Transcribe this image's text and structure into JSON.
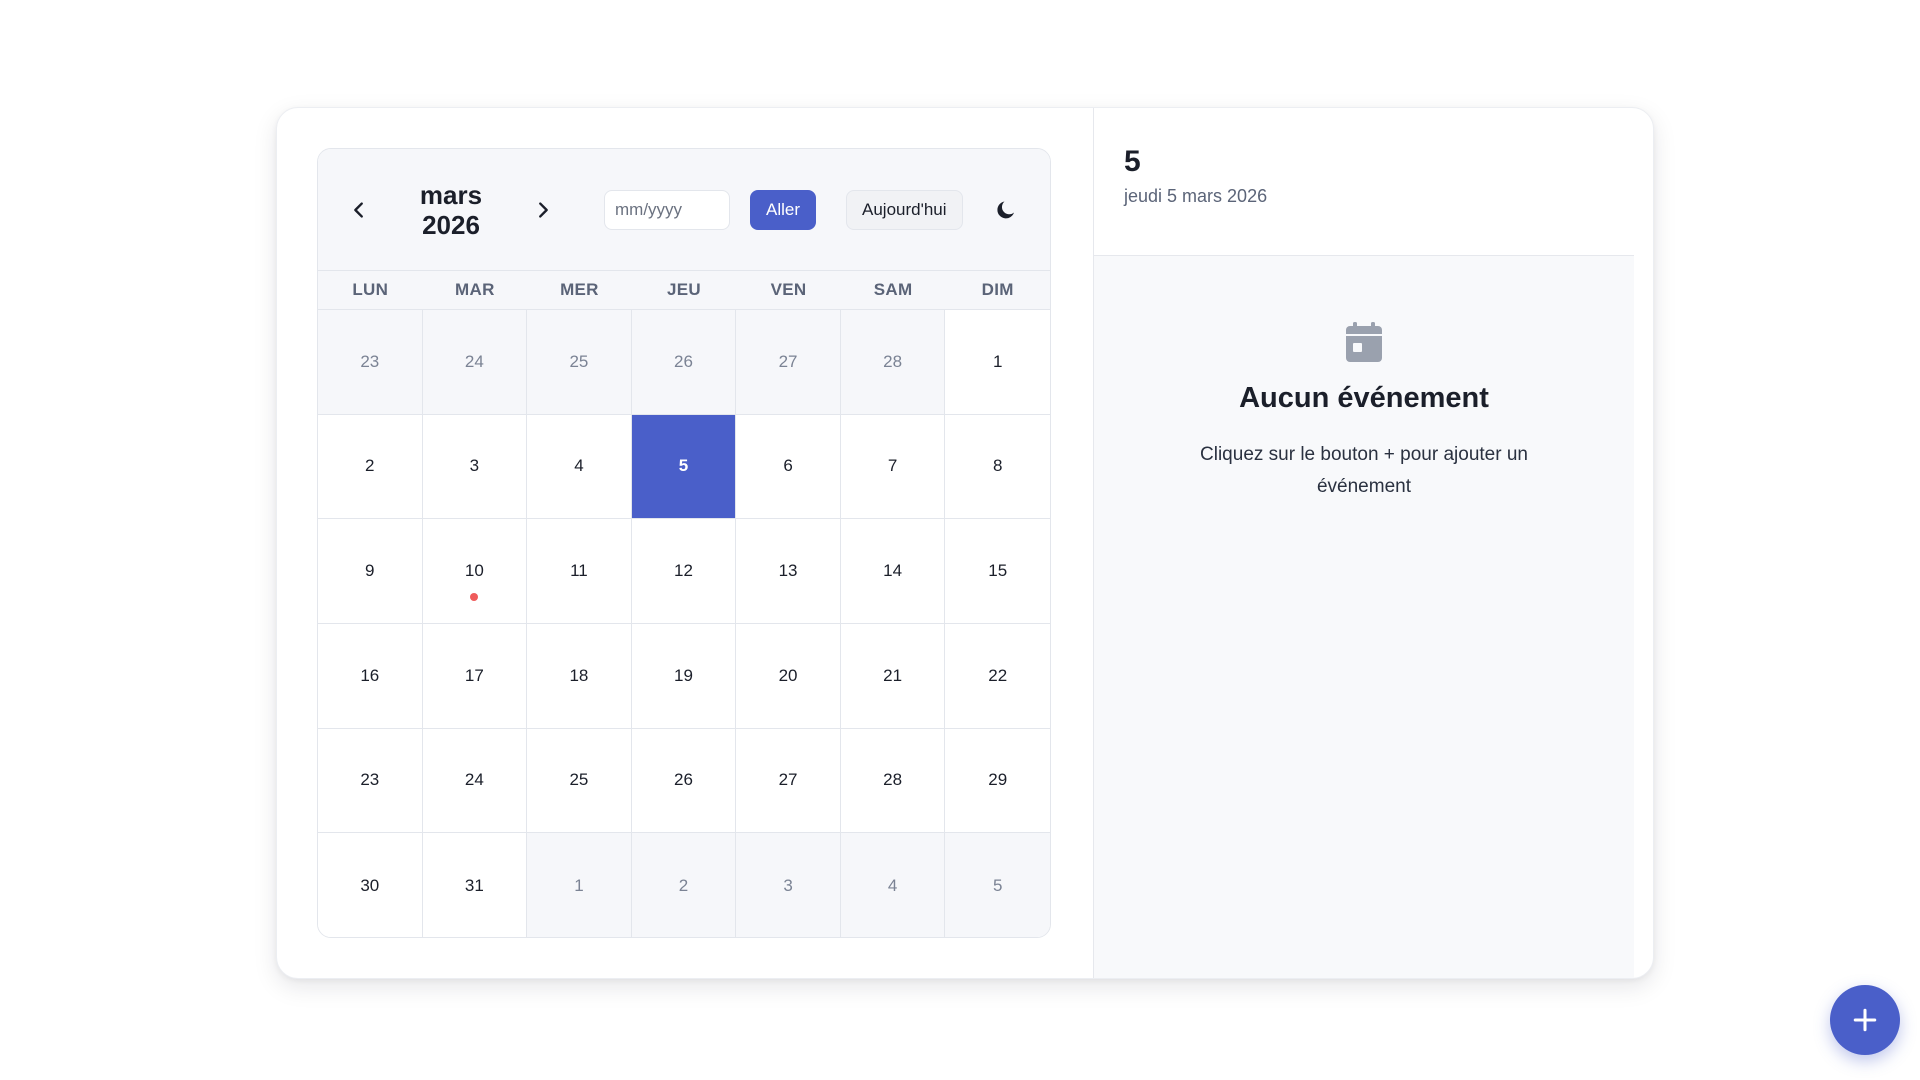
{
  "calendar": {
    "month_name": "mars",
    "year": "2026",
    "input_placeholder": "mm/yyyy",
    "go_label": "Aller",
    "today_label": "Aujourd'hui",
    "weekdays": [
      "LUN",
      "MAR",
      "MER",
      "JEU",
      "VEN",
      "SAM",
      "DIM"
    ],
    "days": [
      {
        "label": "23",
        "other_month": true
      },
      {
        "label": "24",
        "other_month": true
      },
      {
        "label": "25",
        "other_month": true
      },
      {
        "label": "26",
        "other_month": true
      },
      {
        "label": "27",
        "other_month": true
      },
      {
        "label": "28",
        "other_month": true
      },
      {
        "label": "1"
      },
      {
        "label": "2"
      },
      {
        "label": "3"
      },
      {
        "label": "4"
      },
      {
        "label": "5",
        "selected": true
      },
      {
        "label": "6"
      },
      {
        "label": "7"
      },
      {
        "label": "8"
      },
      {
        "label": "9"
      },
      {
        "label": "10",
        "has_event": true
      },
      {
        "label": "11"
      },
      {
        "label": "12"
      },
      {
        "label": "13"
      },
      {
        "label": "14"
      },
      {
        "label": "15"
      },
      {
        "label": "16"
      },
      {
        "label": "17"
      },
      {
        "label": "18"
      },
      {
        "label": "19"
      },
      {
        "label": "20"
      },
      {
        "label": "21"
      },
      {
        "label": "22"
      },
      {
        "label": "23"
      },
      {
        "label": "24"
      },
      {
        "label": "25"
      },
      {
        "label": "26"
      },
      {
        "label": "27"
      },
      {
        "label": "28"
      },
      {
        "label": "29"
      },
      {
        "label": "30"
      },
      {
        "label": "31"
      },
      {
        "label": "1",
        "other_month": true
      },
      {
        "label": "2",
        "other_month": true
      },
      {
        "label": "3",
        "other_month": true
      },
      {
        "label": "4",
        "other_month": true
      },
      {
        "label": "5",
        "other_month": true
      }
    ]
  },
  "side_panel": {
    "day_number": "5",
    "full_date": "jeudi 5 mars 2026",
    "empty_title": "Aucun événement",
    "empty_text": "Cliquez sur le bouton + pour ajouter un événement"
  },
  "icons": {
    "prev": "chevron-left-icon",
    "next": "chevron-right-icon",
    "theme": "moon-icon",
    "empty": "calendar-icon",
    "fab": "plus-icon"
  },
  "colors": {
    "accent": "#4a5fc9",
    "event_dot": "#ef5b5b",
    "muted_bg": "#f6f7fa"
  }
}
